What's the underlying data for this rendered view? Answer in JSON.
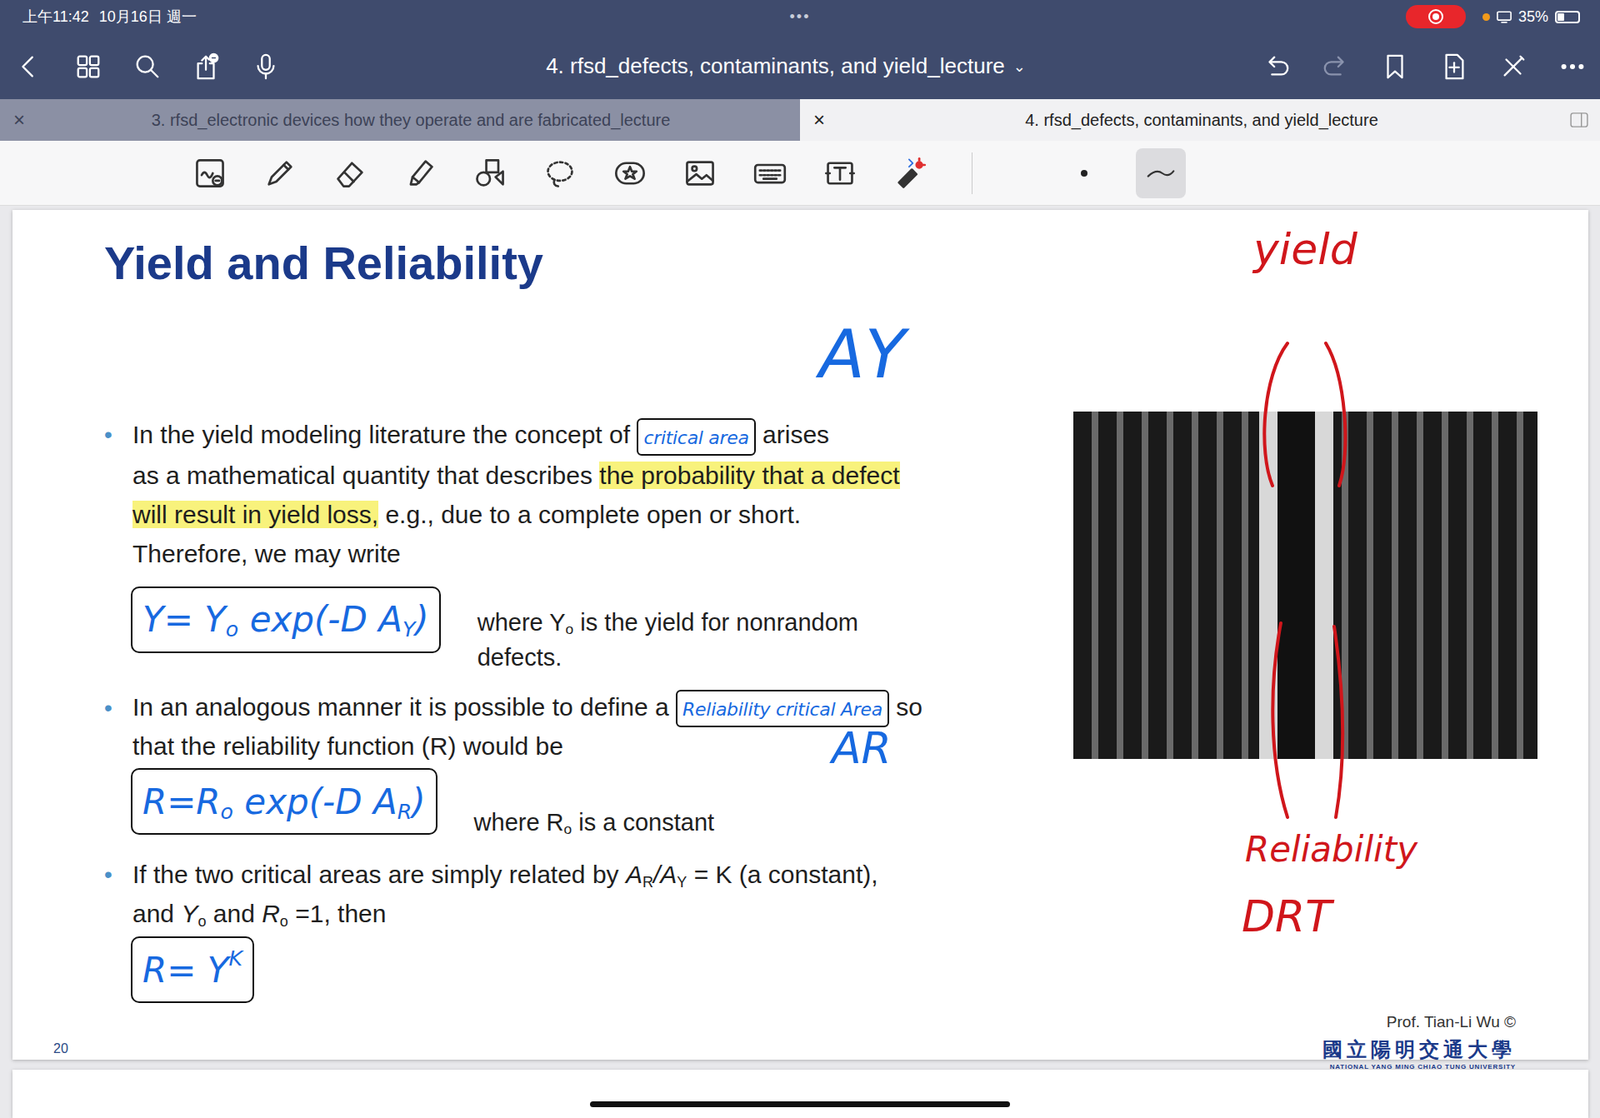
{
  "status_bar": {
    "time": "上午11:42",
    "date": "10月16日 週一",
    "handle": "•••",
    "recording": true,
    "battery": "35%",
    "battery_level": 0.35
  },
  "nav": [
    {
      "kind": "back"
    },
    {
      "kind": "grid"
    },
    {
      "kind": "search"
    },
    {
      "kind": "share"
    },
    {
      "kind": "mic"
    }
  ],
  "toolbar": {
    "title": "4. rfsd_defects, contaminants, and yield_lecture",
    "chevron": "⌄"
  },
  "actions": [
    {
      "kind": "undo",
      "disabled": false
    },
    {
      "kind": "redo",
      "disabled": true
    },
    {
      "kind": "bookmark",
      "disabled": false
    },
    {
      "kind": "add-page",
      "disabled": false
    },
    {
      "kind": "close-pen",
      "disabled": false
    },
    {
      "kind": "more",
      "disabled": false
    }
  ],
  "tabs": [
    {
      "label": "3. rfsd_electronic devices how they operate and are fabricated_lecture",
      "close": "×",
      "selected": false
    },
    {
      "label": "4. rfsd_defects, contaminants, and yield_lecture",
      "close": "×",
      "selected": true
    }
  ],
  "tools": [
    {
      "kind": "zoom",
      "selected": false
    },
    {
      "kind": "pen",
      "selected": false
    },
    {
      "kind": "eraser",
      "selected": false
    },
    {
      "kind": "highlighter",
      "selected": false
    },
    {
      "kind": "shapes",
      "selected": false
    },
    {
      "kind": "lasso",
      "selected": false
    },
    {
      "kind": "sticker",
      "selected": false
    },
    {
      "kind": "image",
      "selected": false
    },
    {
      "kind": "keyboard",
      "selected": false
    },
    {
      "kind": "text",
      "selected": false
    },
    {
      "kind": "laser",
      "selected": false
    }
  ],
  "pen_options": [
    {
      "kind": "size-dot",
      "selected": false
    },
    {
      "kind": "stroke",
      "selected": true
    }
  ],
  "slide": {
    "title": "Yield and Reliability",
    "blocks": [
      {
        "kind": "bullet",
        "lines": [
          [
            {
              "kind": "text",
              "text": "In the yield modeling literature the concept of "
            },
            {
              "kind": "ink-box",
              "text": "critical area"
            },
            {
              "kind": "text",
              "text": " arises"
            }
          ],
          [
            {
              "kind": "text",
              "text": "as a mathematical quantity that describes "
            },
            {
              "kind": "highlight",
              "text": "the probability that a defect"
            }
          ],
          [
            {
              "kind": "highlight",
              "text": "will result in yield loss,"
            },
            {
              "kind": "text",
              "text": " e.g., due to a complete open or short."
            }
          ],
          [
            {
              "kind": "text",
              "text": "Therefore, we may write"
            }
          ]
        ]
      },
      {
        "kind": "equation",
        "ink": [
          {
            "kind": "text",
            "text": "Y= Y"
          },
          {
            "kind": "sub",
            "text": "o"
          },
          {
            "kind": "text",
            "text": " exp(-D A"
          },
          {
            "kind": "sub",
            "text": "Y"
          },
          {
            "kind": "text",
            "text": ")"
          }
        ],
        "lines": [
          [
            {
              "kind": "text",
              "text": "where Y"
            },
            {
              "kind": "sub",
              "text": "o"
            },
            {
              "kind": "text",
              "text": " is the yield for nonrandom"
            }
          ],
          [
            {
              "kind": "text",
              "text": "defects."
            }
          ]
        ]
      },
      {
        "kind": "bullet",
        "lines": [
          [
            {
              "kind": "text",
              "text": "In an analogous manner it is possible to define a "
            },
            {
              "kind": "ink-box",
              "text": "Reliability critical Area"
            },
            {
              "kind": "text",
              "text": " so"
            }
          ],
          [
            {
              "kind": "text",
              "text": "that the reliability function (R) would be"
            }
          ]
        ]
      },
      {
        "kind": "equation",
        "ink": [
          {
            "kind": "text",
            "text": "R=R"
          },
          {
            "kind": "sub",
            "text": "o"
          },
          {
            "kind": "text",
            "text": " exp(-D A"
          },
          {
            "kind": "sub",
            "text": "R"
          },
          {
            "kind": "text",
            "text": ")"
          }
        ],
        "lines": [
          [
            {
              "kind": "text",
              "text": "where R"
            },
            {
              "kind": "sub",
              "text": "o"
            },
            {
              "kind": "text",
              "text": " is a constant"
            }
          ]
        ]
      },
      {
        "kind": "bullet",
        "lines": [
          [
            {
              "kind": "text",
              "text": "If the two critical areas are simply related by "
            },
            {
              "kind": "italic",
              "text": "A"
            },
            {
              "kind": "sub",
              "text": "R"
            },
            {
              "kind": "italic",
              "text": "/A"
            },
            {
              "kind": "sub",
              "text": "Y"
            },
            {
              "kind": "text",
              "text": " = K (a constant),"
            }
          ],
          [
            {
              "kind": "text",
              "text": "and "
            },
            {
              "kind": "italic",
              "text": "Y"
            },
            {
              "kind": "sub",
              "text": "o"
            },
            {
              "kind": "text",
              "text": " and "
            },
            {
              "kind": "italic",
              "text": "R"
            },
            {
              "kind": "sub",
              "text": "o"
            },
            {
              "kind": "text",
              "text": " =1, then"
            }
          ]
        ]
      },
      {
        "kind": "equation",
        "ink": [
          {
            "kind": "text",
            "text": "R= Y"
          },
          {
            "kind": "sup",
            "text": "K"
          }
        ],
        "lines": []
      }
    ],
    "page_number": "20",
    "credit": "Prof. Tian-Li Wu ©",
    "university": "國立陽明交通大學",
    "university_en": "NATIONAL YANG MING CHIAO TUNG UNIVERSITY"
  },
  "ink_notes": [
    {
      "text": "AY",
      "color": "#1769e0",
      "spot": "ay"
    },
    {
      "text": "AR",
      "color": "#1769e0",
      "spot": "ar"
    },
    {
      "text": "yield",
      "color": "#d0161b",
      "spot": "yield"
    },
    {
      "text": "Reliability",
      "color": "#d0161b",
      "spot": "reliability"
    },
    {
      "text": "DRT",
      "color": "#d0161b",
      "spot": "drt"
    }
  ]
}
